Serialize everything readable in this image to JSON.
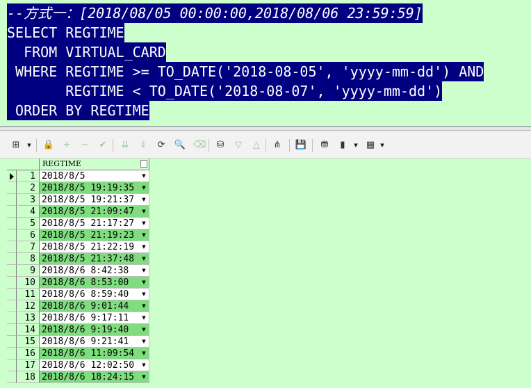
{
  "editor": {
    "lines": [
      "--方式一：[2018/08/05 00:00:00,2018/08/06 23:59:59]",
      "SELECT REGTIME",
      "  FROM VIRTUAL_CARD",
      " WHERE REGTIME >= TO_DATE('2018-08-05', 'yyyy-mm-dd') AND",
      "       REGTIME < TO_DATE('2018-08-07', 'yyyy-mm-dd')",
      " ORDER BY REGTIME"
    ],
    "colors": {
      "background": "#ccffcc",
      "selection": "#000080",
      "selection_text": "#ffffff"
    }
  },
  "toolbar": {
    "icons": {
      "grid": "⊞",
      "dropdown": "▼",
      "lock": "🔒",
      "add": "+",
      "remove": "−",
      "post": "✔",
      "fetch_next": "⇊",
      "fetch_last": "⇓",
      "refresh": "⟳",
      "find": "🔍",
      "clear": "⌫",
      "query_by_example": "⛁",
      "prior": "▽",
      "next": "△",
      "explain": "⋔",
      "save": "💾",
      "export": "⛃",
      "chart": "▮",
      "table_menu": "▦"
    }
  },
  "grid": {
    "column_header": "REGTIME",
    "dropdown_glyph": "▼",
    "rows": [
      {
        "num": "1",
        "value": "2018/8/5"
      },
      {
        "num": "2",
        "value": "2018/8/5 19:19:35"
      },
      {
        "num": "3",
        "value": "2018/8/5 19:21:37"
      },
      {
        "num": "4",
        "value": "2018/8/5 21:09:47"
      },
      {
        "num": "5",
        "value": "2018/8/5 21:17:27"
      },
      {
        "num": "6",
        "value": "2018/8/5 21:19:23"
      },
      {
        "num": "7",
        "value": "2018/8/5 21:22:19"
      },
      {
        "num": "8",
        "value": "2018/8/5 21:37:48"
      },
      {
        "num": "9",
        "value": "2018/8/6 8:42:38"
      },
      {
        "num": "10",
        "value": "2018/8/6 8:53:00"
      },
      {
        "num": "11",
        "value": "2018/8/6 8:59:40"
      },
      {
        "num": "12",
        "value": "2018/8/6 9:01:44"
      },
      {
        "num": "13",
        "value": "2018/8/6 9:17:11"
      },
      {
        "num": "14",
        "value": "2018/8/6 9:19:40"
      },
      {
        "num": "15",
        "value": "2018/8/6 9:21:41"
      },
      {
        "num": "16",
        "value": "2018/8/6 11:09:54"
      },
      {
        "num": "17",
        "value": "2018/8/6 12:02:50"
      },
      {
        "num": "18",
        "value": "2018/8/6 18:24:15"
      }
    ]
  }
}
